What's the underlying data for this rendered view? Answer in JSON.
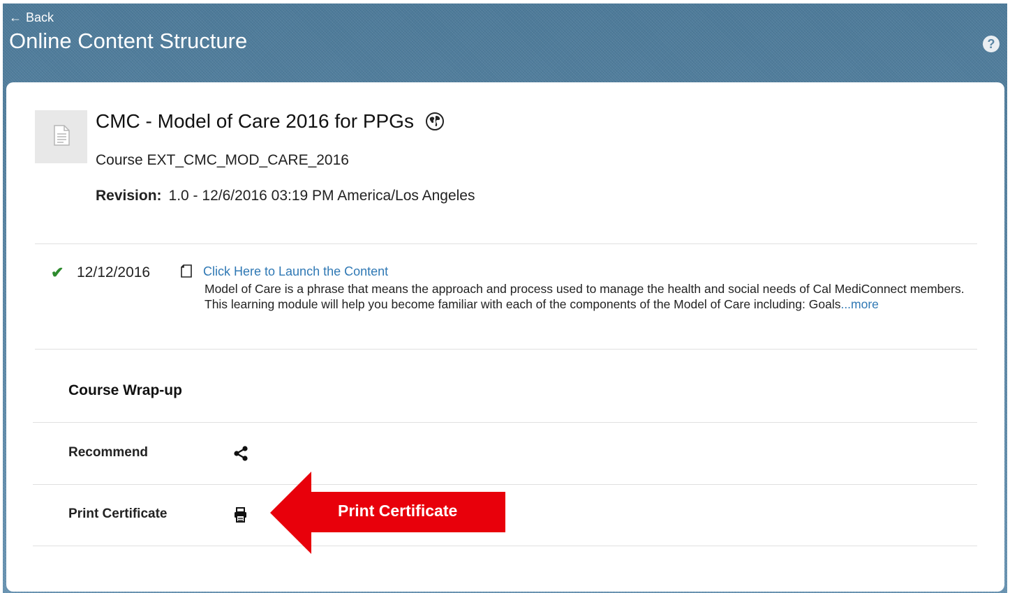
{
  "header": {
    "back_label": "Back",
    "back_arrow": "←",
    "title": "Online Content Structure",
    "help_glyph": "?"
  },
  "course": {
    "title": "CMC - Model of Care 2016 for PPGs",
    "code_line": "Course EXT_CMC_MOD_CARE_2016",
    "revision_label": "Revision:",
    "revision_value": "1.0 - 12/6/2016 03:19 PM America/Los Angeles"
  },
  "content_item": {
    "status_glyph": "✔",
    "date": "12/12/2016",
    "launch_label": "Click Here to Launch the Content",
    "description": "Model of Care is a phrase that means the approach and process used to manage the health and social needs of Cal MediConnect members. This learning module will help you become familiar with each of the components of the Model of Care including: Goals",
    "more_label": "...more"
  },
  "wrapup": {
    "heading": "Course Wrap-up",
    "recommend_label": "Recommend",
    "print_label": "Print Certificate"
  },
  "annotation": {
    "callout_text": "Print Certificate"
  },
  "colors": {
    "banner": "#5a86a4",
    "link": "#2f78b4",
    "check": "#2e8b2e",
    "callout": "#e8000b"
  },
  "icons": {
    "thumbnail": "document-icon",
    "globe": "globe-icon",
    "content": "document-outline-icon",
    "recommend": "share-icon",
    "print": "printer-icon"
  }
}
